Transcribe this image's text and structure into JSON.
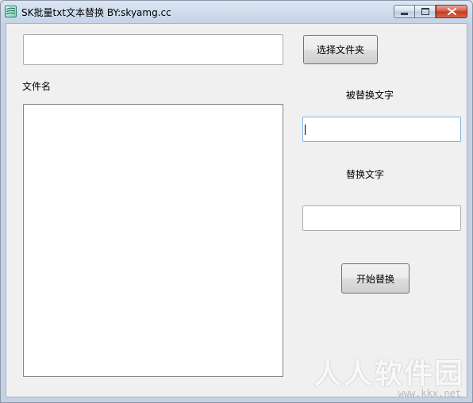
{
  "window": {
    "title": "SK批量txt文本替换 BY:skyamg.cc",
    "icon": "app-icon",
    "controls": [
      "minimize-icon",
      "maximize-icon",
      "close-icon"
    ]
  },
  "folder": {
    "path_value": "",
    "select_button_label": "选择文件夹"
  },
  "file_list": {
    "label": "文件名",
    "items": []
  },
  "find": {
    "label": "被替换文字",
    "value": ""
  },
  "replace": {
    "label": "替换文字",
    "value": ""
  },
  "actions": {
    "start_label": "开始替换"
  },
  "watermark": {
    "text": "人人软件园",
    "url": "www.kkx.net"
  },
  "colors": {
    "close_button": "#c1381d",
    "focus_border": "#7eb4ea"
  }
}
